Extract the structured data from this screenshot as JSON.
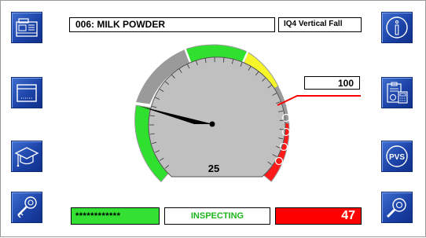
{
  "header": {
    "product": "006: MILK POWDER",
    "mode": "IQ4 Vertical Fall"
  },
  "gauge": {
    "threshold": "100",
    "center_value": "25",
    "pointer_value": 25
  },
  "footer": {
    "password": "************",
    "status": "INSPECTING",
    "reject_count": "47"
  },
  "colors": {
    "button_blue": "#1c43a8",
    "zone_green": "#2fe02f",
    "zone_yellow": "#f5f52a",
    "zone_red": "#ff1a1a",
    "dial_gray": "#c0c0c0",
    "status_green": "#1cb41c"
  },
  "icons": {
    "left": [
      "machine-icon",
      "box-icon",
      "graduation-cap-icon",
      "key-icon"
    ],
    "right": [
      "info-icon",
      "clipboard-calculator-icon",
      "pvs-icon",
      "magnifier-icon"
    ],
    "pvs_label": "PVS"
  }
}
